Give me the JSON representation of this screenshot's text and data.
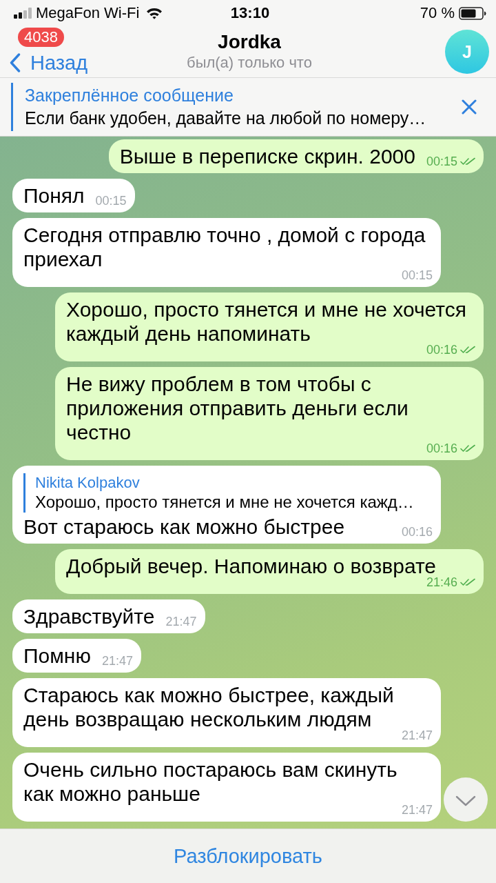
{
  "status_bar": {
    "carrier": "MegaFon Wi-Fi",
    "time": "13:10",
    "battery": "70 %"
  },
  "header": {
    "back": {
      "label": "Назад",
      "badge": "4038"
    },
    "title": "Jordka",
    "subtitle": "был(а) только что",
    "avatar": {
      "initial": "J"
    }
  },
  "pinned": {
    "title": "Закреплённое сообщение",
    "text": "Если банк удобен, давайте на любой по номеру…"
  },
  "messages": [
    {
      "kind": "outgoing",
      "text": "Выше в переписке скрин. 2000",
      "time": "00:15",
      "read": true
    },
    {
      "kind": "incoming",
      "text": "Понял",
      "time": "00:15"
    },
    {
      "kind": "incoming",
      "text": "Сегодня отправлю точно , домой с города приехал",
      "time": "00:15"
    },
    {
      "kind": "outgoing",
      "text": "Хорошо, просто тянется и мне не хочется каждый день напоминать",
      "time": "00:16",
      "read": true
    },
    {
      "kind": "outgoing",
      "text": "Не вижу проблем в том чтобы с приложения отправить деньги если честно",
      "time": "00:16",
      "read": true
    },
    {
      "kind": "incoming",
      "reply": {
        "name": "Nikita Kolpakov",
        "text": "Хорошо, просто тянется и мне не хочется кажд…"
      },
      "text": "Вот стараюсь как можно быстрее",
      "time": "00:16"
    },
    {
      "kind": "outgoing",
      "text": "Добрый вечер. Напоминаю о возврате",
      "time": "21:46",
      "read": true
    },
    {
      "kind": "incoming",
      "text": "Здравствуйте",
      "time": "21:47"
    },
    {
      "kind": "incoming",
      "text": "Помню",
      "time": "21:47"
    },
    {
      "kind": "incoming",
      "text": "Стараюсь как можно быстрее, каждый день возвращаю нескольким людям",
      "time": "21:47"
    },
    {
      "kind": "incoming",
      "text": "Очень сильно постараюсь вам скинуть как можно раньше",
      "time": "21:47"
    }
  ],
  "footer": {
    "button": "Разблокировать"
  }
}
